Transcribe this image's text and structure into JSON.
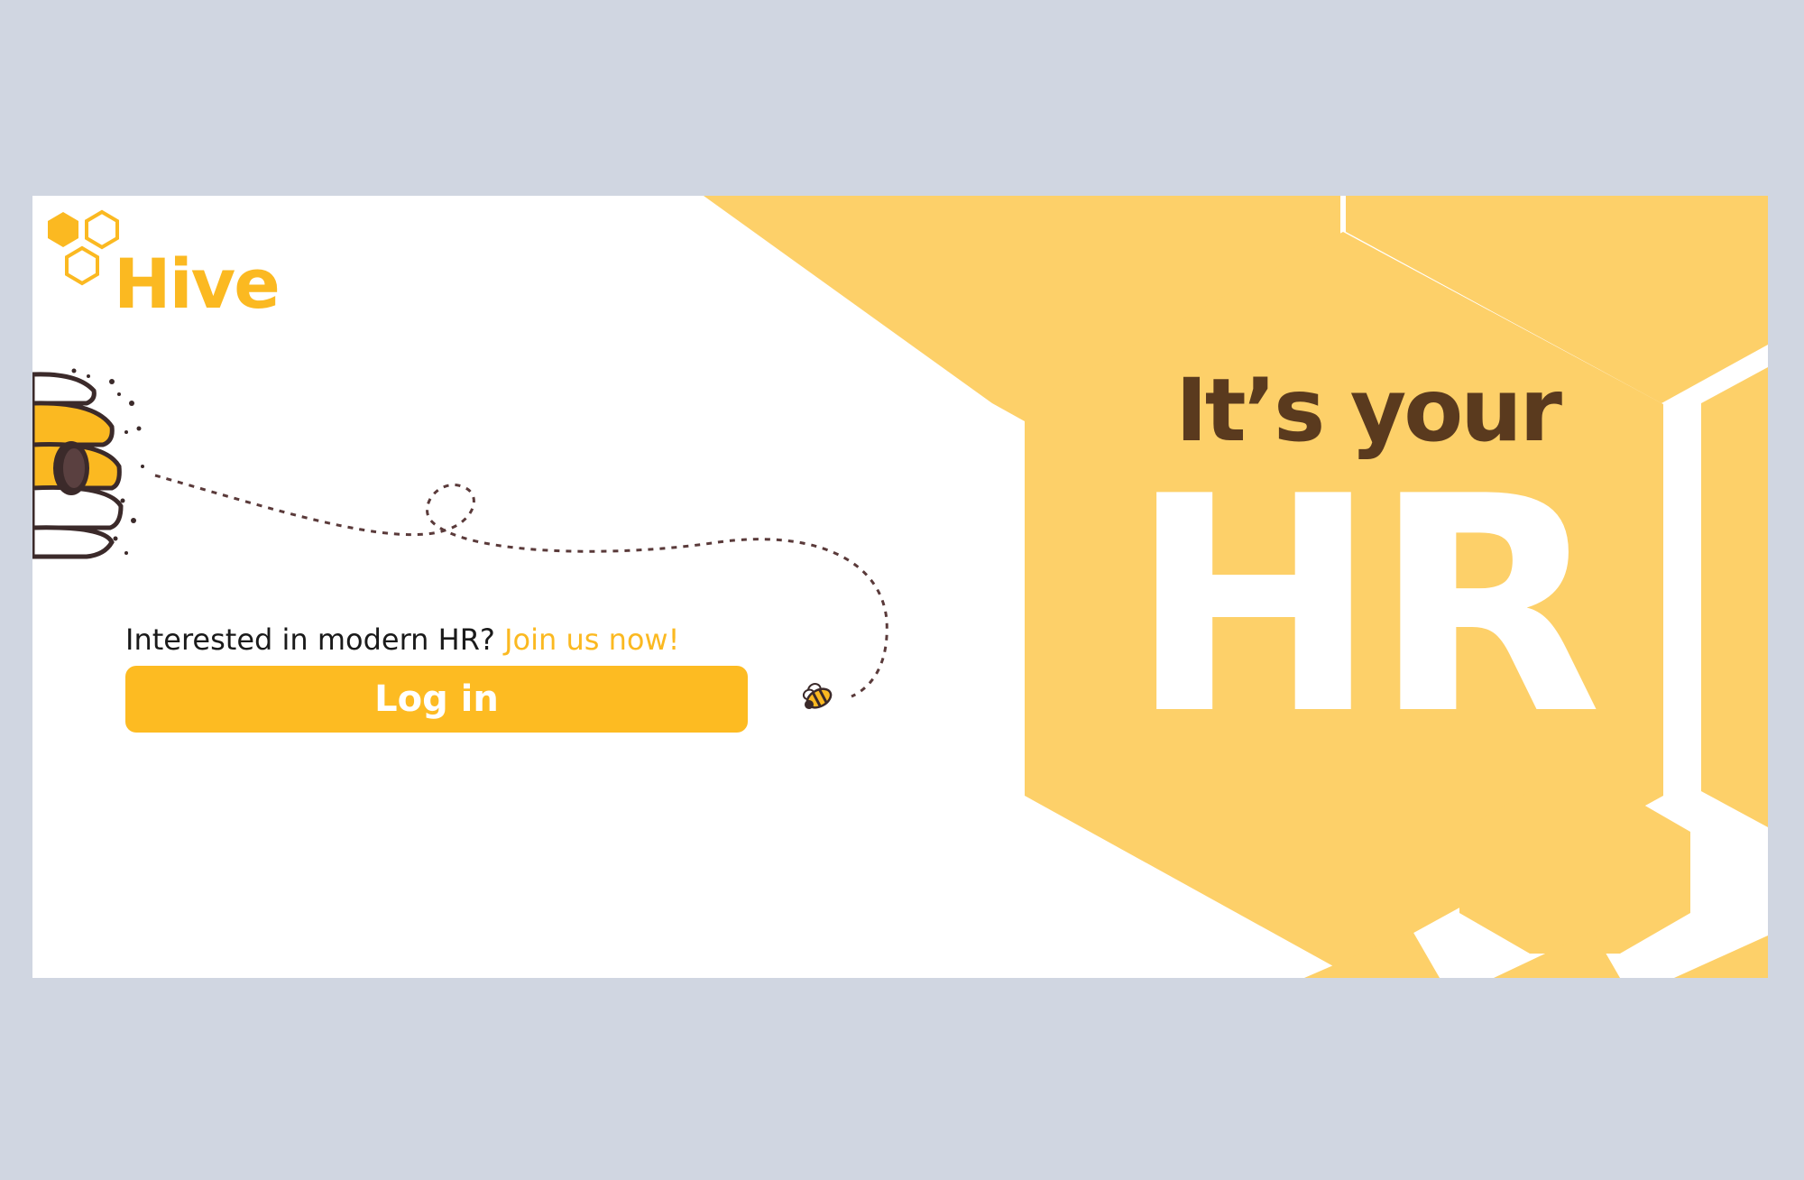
{
  "brand": {
    "name": "Hive",
    "primary_color": "#fbb921",
    "honeycomb_color": "#fdd069",
    "text_brown": "#5a3a1e",
    "page_background": "#d0d6e1"
  },
  "login": {
    "prompt": "Interested in modern HR?",
    "join_link": "Join us now!",
    "button_label": "Log in"
  },
  "hero": {
    "line1": "It’s your",
    "line2": "HR"
  },
  "icons": {
    "logo": "honeycomb-cells-icon",
    "hive": "beehive-icon",
    "bee": "bee-icon"
  }
}
